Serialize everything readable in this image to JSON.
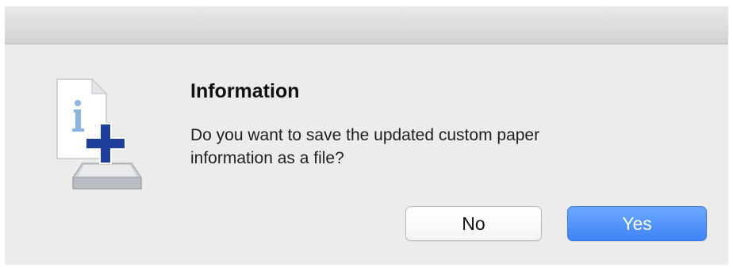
{
  "dialog": {
    "title": "Information",
    "message_line1": "Do you want to save the updated custom paper",
    "message_line2": "information as a file?",
    "icon": "info-document-add-icon",
    "buttons": {
      "no_label": "No",
      "yes_label": "Yes"
    }
  },
  "colors": {
    "background": "#ececec",
    "primary_button": "#4a8df8",
    "icon_plus": "#1f3f9c",
    "icon_info": "#8fb3e0"
  }
}
